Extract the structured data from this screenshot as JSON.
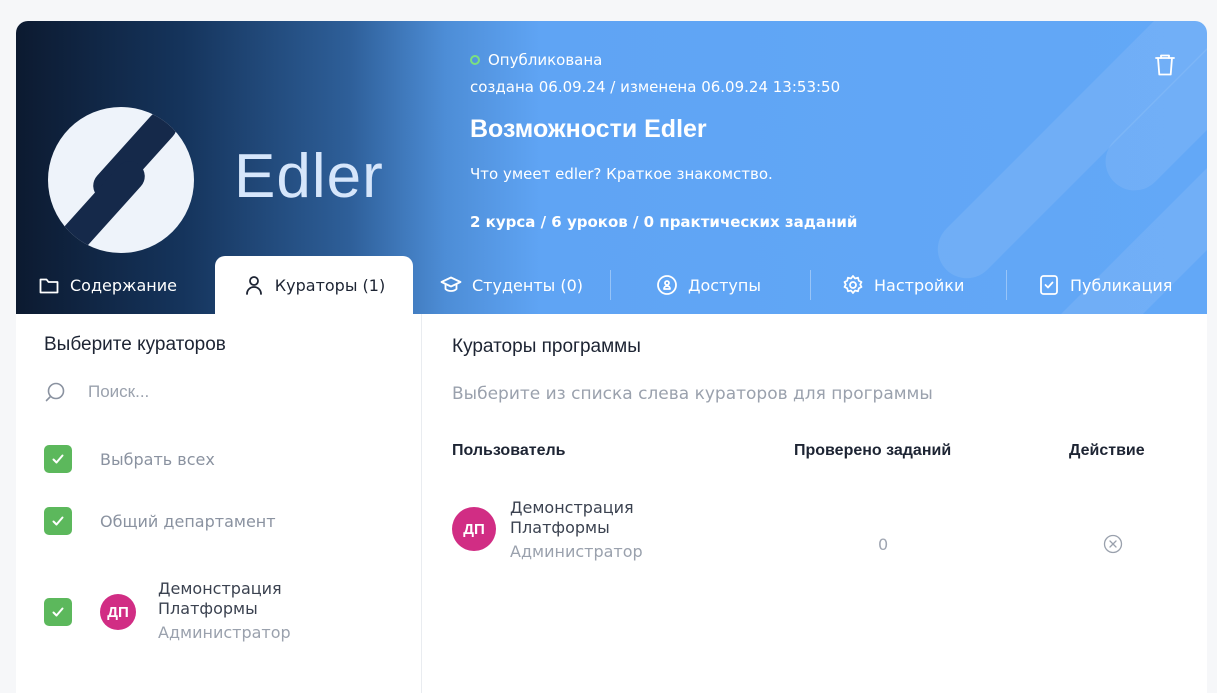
{
  "header": {
    "status": "Опубликована",
    "dates": "создана 06.09.24 / изменена 06.09.24 13:53:50",
    "title": "Возможности Edler",
    "subtitle": "Что умеет edler? Краткое знакомство.",
    "stats": "2 курса / 6 уроков / 0 практических заданий",
    "logo_text": "Edler",
    "status_color": "#7be07f"
  },
  "tabs": [
    {
      "label": "Содержание",
      "icon": "folder-icon"
    },
    {
      "label": "Кураторы (1)",
      "icon": "user-icon",
      "active": true
    },
    {
      "label": "Студенты (0)",
      "icon": "graduation-cap-icon"
    },
    {
      "label": "Доступы",
      "icon": "shield-icon"
    },
    {
      "label": "Настройки",
      "icon": "gear-icon"
    },
    {
      "label": "Публикация",
      "icon": "checkmark-square-icon"
    }
  ],
  "left": {
    "heading": "Выберите кураторов",
    "search_placeholder": "Поиск...",
    "select_all": "Выбрать всех",
    "department": "Общий департамент",
    "user": {
      "initials": "ДП",
      "name": "Демонстрация Платформы",
      "role": "Администратор"
    }
  },
  "right": {
    "heading": "Кураторы программы",
    "hint": "Выберите из списка слева кураторов для программы",
    "columns": [
      "Пользователь",
      "Проверено заданий",
      "Действие"
    ],
    "rows": [
      {
        "initials": "ДП",
        "name": "Демонстрация Платформы",
        "role": "Администратор",
        "checked": "0"
      }
    ]
  },
  "colors": {
    "accent_blue": "#63a8f7",
    "check_green": "#5cb85c",
    "avatar_pink": "#d12d84"
  }
}
